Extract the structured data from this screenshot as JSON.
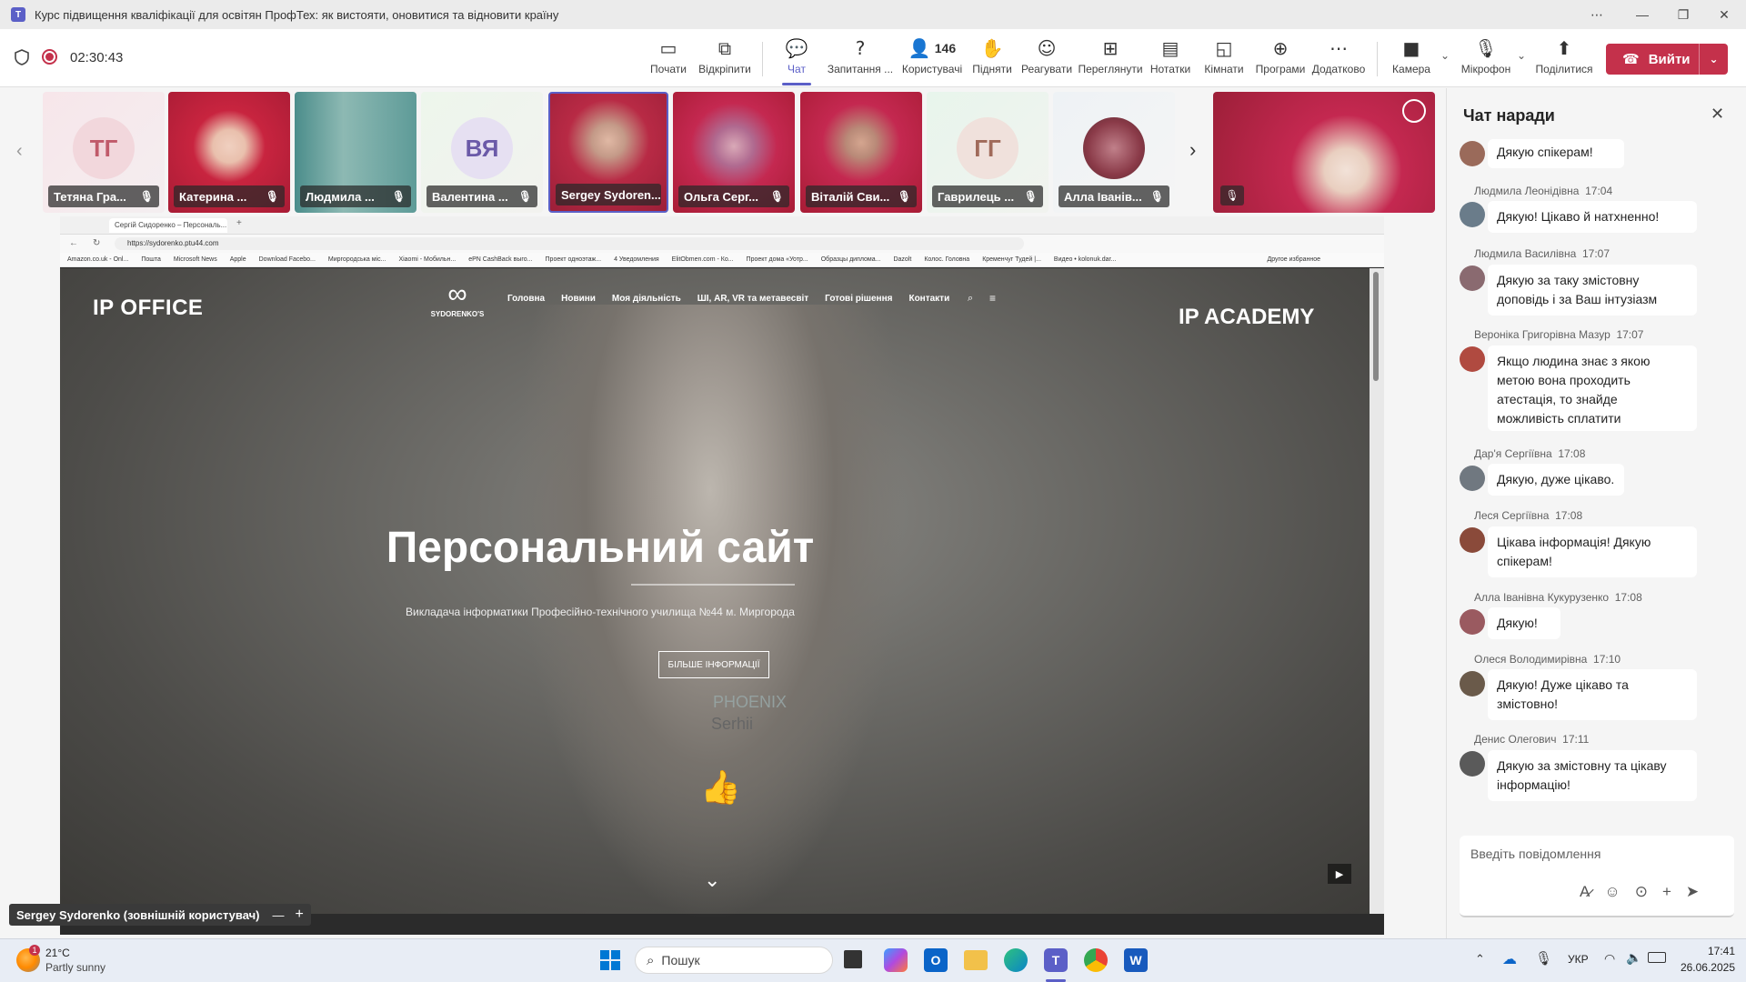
{
  "window": {
    "title": "Курс підвищення кваліфікації для освітян ПрофТех: як вистояти, оновитися та відновити країну",
    "controls": [
      "⋯",
      "—",
      "❐",
      "✕"
    ]
  },
  "meeting": {
    "timer": "02:30:43",
    "participants_count": "146",
    "toolbar": [
      {
        "label": "Почати",
        "icon": "start-icon"
      },
      {
        "label": "Відкріпити",
        "icon": "popout-icon"
      },
      {
        "label": "Чат",
        "icon": "chat-icon"
      },
      {
        "label": "Запитання ...",
        "icon": "qa-icon"
      },
      {
        "label": "Користувачі",
        "icon": "people-icon"
      },
      {
        "label": "Підняти",
        "icon": "raise-hand-icon"
      },
      {
        "label": "Реагувати",
        "icon": "react-icon"
      },
      {
        "label": "Переглянути",
        "icon": "view-icon"
      },
      {
        "label": "Нотатки",
        "icon": "notes-icon"
      },
      {
        "label": "Кімнати",
        "icon": "rooms-icon"
      },
      {
        "label": "Програми",
        "icon": "apps-icon"
      },
      {
        "label": "Додатково",
        "icon": "more-icon"
      },
      {
        "label": "Камера",
        "icon": "camera-icon"
      },
      {
        "label": "Мікрофон",
        "icon": "mic-off-icon"
      },
      {
        "label": "Поділитися",
        "icon": "share-icon"
      }
    ],
    "leave_label": "Вийти"
  },
  "participants": [
    {
      "name": "Тетяна Гра...",
      "initials": "ТГ"
    },
    {
      "name": "Катерина ..."
    },
    {
      "name": "Людмила ..."
    },
    {
      "name": "Валентина ...",
      "initials": "ВЯ"
    },
    {
      "name": "Sergey Sydoren..."
    },
    {
      "name": "Ольга Серг..."
    },
    {
      "name": "Віталій Сви..."
    },
    {
      "name": "Гаврилець ...",
      "initials": "ГГ"
    },
    {
      "name": "Алла Іванів..."
    }
  ],
  "share": {
    "presenter_label": "Sergey Sydorenko (зовнішній користувач)",
    "browser": {
      "tab_title": "Сергій Сидоренко – Персональ...",
      "url": "https://sydorenko.ptu44.com",
      "bookmarks": [
        "Amazon.co.uk - Onl...",
        "Пошта",
        "Microsoft News",
        "Apple",
        "Download Facebo...",
        "Миргородська міс...",
        "Xiaomi - Мобильн...",
        "ePN CashBack выго...",
        "Проект одноэтаж...",
        "4 Уведомления",
        "ElitObmen.com - Ко...",
        "Проект дома «Уотр...",
        "Образцы диплома...",
        "Dazolt",
        "Колос. Головна",
        "Кременчуг Тудей |...",
        "Видео • kolonuk.dar...",
        "Другое избранное"
      ]
    },
    "site": {
      "logo_left": "IP OFFICE",
      "brand": "SYDORENKO'S",
      "logo_right": "IP ACADEMY",
      "nav": [
        "Головна",
        "Новини",
        "Моя діяльність",
        "ШІ, AR, VR та метавесвіт",
        "Готові рішення",
        "Контакти"
      ],
      "hero_title": "Персональний сайт",
      "hero_subtitle": "Викладача інформатики Професійно-технічного училища №44 м. Миргорода",
      "hero_button": "БІЛЬШЕ ІНФОРМАЦІЇ",
      "badge_text": "PHOENIX",
      "badge_name": "Serhii",
      "reaction": "👍"
    }
  },
  "chat": {
    "title": "Чат наради",
    "messages": [
      {
        "author": "",
        "time": "",
        "text": "Дякую спікерам!"
      },
      {
        "author": "Людмила Леонідівна",
        "time": "17:04",
        "text": "Дякую! Цікаво й натхненно!"
      },
      {
        "author": "Людмила Василівна",
        "time": "17:07",
        "text": "Дякую за таку змістовну доповідь і за Ваш інтузіазм"
      },
      {
        "author": "Вероніка Григорівна Мазур",
        "time": "17:07",
        "text": "Якщо людина знає з якою метою вона проходить атестація, то знайде можливість сплатити"
      },
      {
        "author": "Дар'я Сергіївна",
        "time": "17:08",
        "text": "Дякую, дуже цікаво."
      },
      {
        "author": "Леся Сергіївна",
        "time": "17:08",
        "text": "Цікава інформація! Дякую спікерам!"
      },
      {
        "author": "Алла Іванівна Кукурузенко",
        "time": "17:08",
        "text": "Дякую!"
      },
      {
        "author": "Олеся Володимирівна",
        "time": "17:10",
        "text": "Дякую! Дуже цікаво та змістовно!"
      },
      {
        "author": "Денис Олегович",
        "time": "17:11",
        "text": "Дякую за змістовну та цікаву інформацію!"
      }
    ],
    "input_placeholder": "Введіть повідомлення"
  },
  "taskbar": {
    "weather_temp": "21°C",
    "weather_desc": "Partly sunny",
    "weather_badge": "1",
    "search_placeholder": "Пошук",
    "lang": "УКР",
    "time": "17:41",
    "date": "26.06.2025"
  },
  "colors": {
    "accent": "#5b5fc7",
    "leave": "#c4314b",
    "tile_red": "#c42850"
  }
}
